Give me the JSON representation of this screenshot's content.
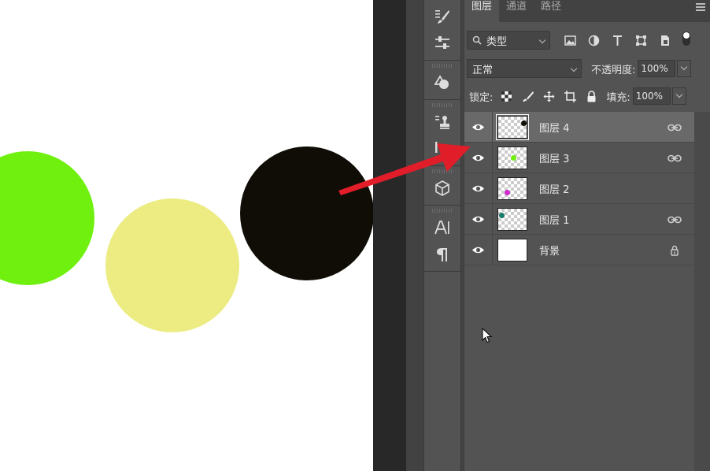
{
  "canvas": {
    "circles": [
      {
        "name": "green-circle",
        "color": "#6ff00f"
      },
      {
        "name": "yellow-circle",
        "color": "#ecec83"
      },
      {
        "name": "black-circle",
        "color": "#0f0d05"
      }
    ]
  },
  "tool_strip": {
    "tools": [
      "brush-icon",
      "adjustments-icon",
      "shapes-icon",
      "stamp-icon",
      "scissors-icon",
      "3d-cube-icon",
      "character-icon",
      "paragraph-icon"
    ]
  },
  "panel": {
    "tabs": [
      {
        "label": "图层",
        "active": true
      },
      {
        "label": "通道",
        "active": false
      },
      {
        "label": "路径",
        "active": false
      }
    ],
    "filter": {
      "label": "类型"
    },
    "filter_icons": [
      "image-filter-icon",
      "adjustment-filter-icon",
      "type-filter-icon",
      "shape-filter-icon",
      "smart-object-filter-icon"
    ],
    "blend_mode": "正常",
    "opacity_label": "不透明度:",
    "opacity_value": "100%",
    "lock_label": "锁定:",
    "fill_label": "填充:",
    "fill_value": "100%"
  },
  "layers": [
    {
      "name": "图层 4",
      "selected": true,
      "dot_color": "#0f0d05",
      "linked": true
    },
    {
      "name": "图层 3",
      "selected": false,
      "dot_color": "#6ff00f",
      "linked": true
    },
    {
      "name": "图层 2",
      "selected": false,
      "dot_color": "#d02ad0",
      "linked": false
    },
    {
      "name": "图层 1",
      "selected": false,
      "dot_color": "#1a7a6a",
      "linked": true
    },
    {
      "name": "背景",
      "selected": false,
      "dot_color": null,
      "locked": true
    }
  ],
  "colors": {
    "arrow": "#e11d2a",
    "panel_bg": "#535353",
    "selected_row": "#696969"
  }
}
